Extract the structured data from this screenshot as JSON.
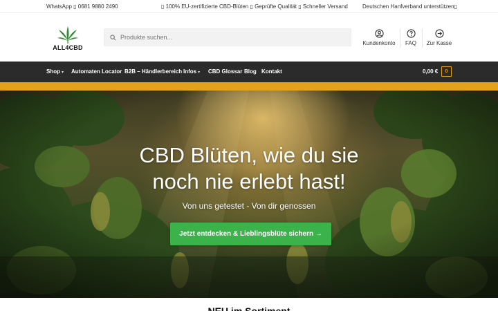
{
  "topbar": {
    "whatsapp": "WhatsApp ▯  0681 9880 2490",
    "usp": "▯ 100% EU-zertifizierte CBD-Blüten ▯ Geprüfte Qualität ▯ Schneller Versand",
    "association": "Deutschen Hanfverband unterstützen▯"
  },
  "header": {
    "logo_text": "ALL4CBD",
    "search_placeholder": "Produkte suchen...",
    "account_label": "Kundenkonto",
    "faq_label": "FAQ",
    "checkout_label": "Zur Kasse"
  },
  "nav": {
    "items": [
      {
        "label": "Shop",
        "has_dropdown": true
      },
      {
        "label": "Automaten Locator",
        "has_dropdown": false
      },
      {
        "label": "B2B – Händlerbereich",
        "has_dropdown": false
      },
      {
        "label": "Infos",
        "has_dropdown": true
      },
      {
        "label": "CBD Glossar",
        "has_dropdown": false
      },
      {
        "label": "Blog",
        "has_dropdown": false
      },
      {
        "label": "Kontakt",
        "has_dropdown": false
      }
    ],
    "cart_total": "0,00 €",
    "cart_count": "0"
  },
  "hero": {
    "title_line1": "CBD Blüten, wie du sie",
    "title_line2": "noch nie erlebt hast!",
    "subtitle": "Von uns getestet - Von dir genossen",
    "cta": "Jetzt entdecken & Lieblingsblüte sichern →"
  },
  "section": {
    "title": "NEU im Sortiment"
  },
  "colors": {
    "nav_bg": "#2b2b2b",
    "accent_gold": "#e2a21b",
    "cta_green": "#3bb24a",
    "logo_leaf": "#2f8a2c"
  },
  "icons": [
    "whatsapp-icon",
    "search-icon",
    "user-icon",
    "help-icon",
    "arrow-right-circle-icon",
    "chevron-down-icon",
    "cannabis-leaf-icon"
  ]
}
